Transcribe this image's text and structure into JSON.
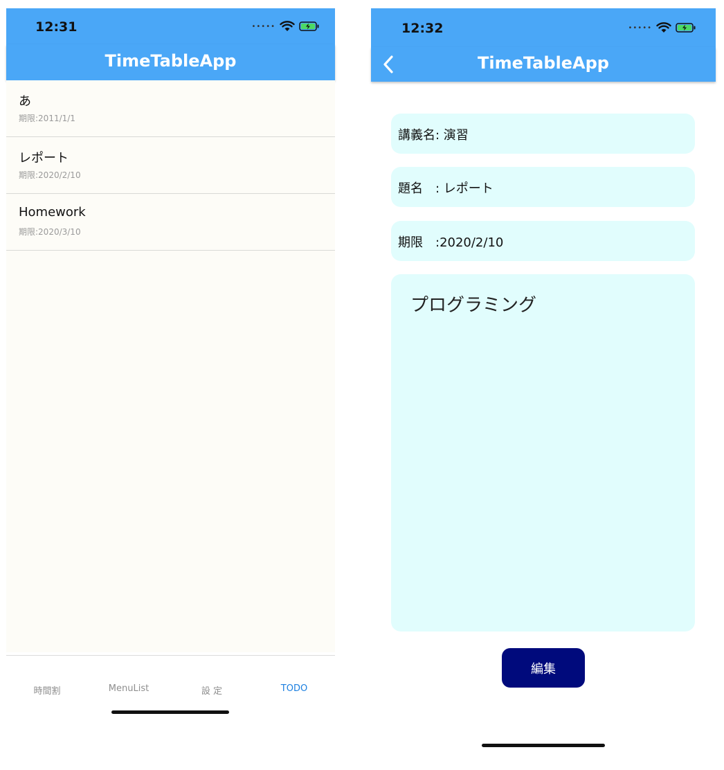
{
  "left": {
    "status": {
      "time": "12:31"
    },
    "app_title": "TimeTableApp",
    "todos": [
      {
        "title": "あ",
        "due": "期限:2011/1/1"
      },
      {
        "title": "レポート",
        "due": "期限:2020/2/10"
      },
      {
        "title": "Homework",
        "due": "期限:2020/3/10"
      }
    ],
    "tabs": [
      {
        "label": "時間割",
        "active": false
      },
      {
        "label": "MenuList",
        "active": false
      },
      {
        "label": "設 定",
        "active": false
      },
      {
        "label": "TODO",
        "active": true
      }
    ]
  },
  "right": {
    "status": {
      "time": "12:32"
    },
    "app_title": "TimeTableApp",
    "fields": {
      "lecture": "講義名: 演習",
      "title": "題名　: レポート",
      "deadline": "期限　:2020/2/10"
    },
    "memo": "プログラミング",
    "edit_button": "編集"
  },
  "colors": {
    "app_bar": "#4aa7f7",
    "list_bg": "#fdfcf7",
    "field_bg": "#e1fdfd",
    "active_tab": "#1b7fe0",
    "button_bg": "#000a7c"
  },
  "icons": {
    "status": [
      "signal-dots-icon",
      "wifi-icon",
      "battery-charging-icon"
    ],
    "back": "chevron-left-icon"
  }
}
